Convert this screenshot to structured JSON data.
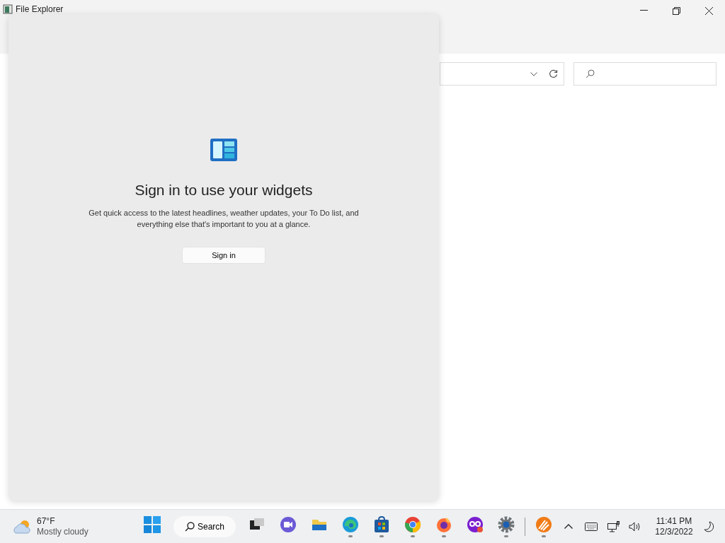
{
  "window": {
    "title": "File Explorer"
  },
  "widgets_panel": {
    "heading": "Sign in to use your widgets",
    "description": "Get quick access to the latest headlines, weather updates, your To Do list, and everything else that's important to you at a glance.",
    "button": "Sign in"
  },
  "taskbar": {
    "weather": {
      "temperature": "67°F",
      "condition": "Mostly cloudy"
    },
    "search_label": "Search",
    "apps": [
      {
        "kind": "taskview",
        "running": false
      },
      {
        "kind": "chat",
        "running": false
      },
      {
        "kind": "explorer",
        "running": false
      },
      {
        "kind": "edge",
        "running": true
      },
      {
        "kind": "store",
        "running": true
      },
      {
        "kind": "chrome",
        "running": true
      },
      {
        "kind": "firefox",
        "running": true
      },
      {
        "kind": "mask",
        "running": false
      },
      {
        "kind": "settings",
        "running": true
      },
      {
        "kind": "separator"
      },
      {
        "kind": "orange",
        "running": true
      }
    ],
    "clock": {
      "time": "11:41 PM",
      "date": "12/3/2022"
    }
  }
}
